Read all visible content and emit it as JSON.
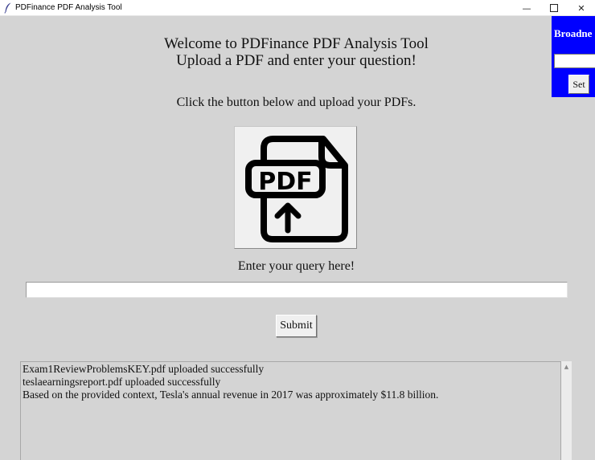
{
  "window": {
    "title": "PDFinance PDF Analysis Tool",
    "controls": {
      "minimize": "—",
      "close": "✕"
    }
  },
  "main": {
    "welcome_line1": "Welcome to PDFinance PDF Analysis Tool",
    "welcome_line2": "Upload a PDF and enter your question!",
    "upload_instructions": "Click the button below and upload your PDFs.",
    "upload_button": {
      "icon": "pdf-upload-icon",
      "icon_text": "PDF"
    },
    "query_label": "Enter your query here!",
    "query_input": {
      "value": "",
      "placeholder": ""
    },
    "submit_label": "Submit",
    "output_lines": [
      "Exam1ReviewProblemsKEY.pdf uploaded successfully",
      "teslaearningsreport.pdf uploaded successfully",
      "Based on the provided context, Tesla's annual revenue in 2017 was approximately $11.8 billion."
    ]
  },
  "broadcast_panel": {
    "label": "Broadne",
    "input_value": "",
    "set_label": "Set",
    "background_color": "#0000ff"
  },
  "colors": {
    "window_background": "#d4d4d4",
    "button_face": "#f0f0f0"
  }
}
